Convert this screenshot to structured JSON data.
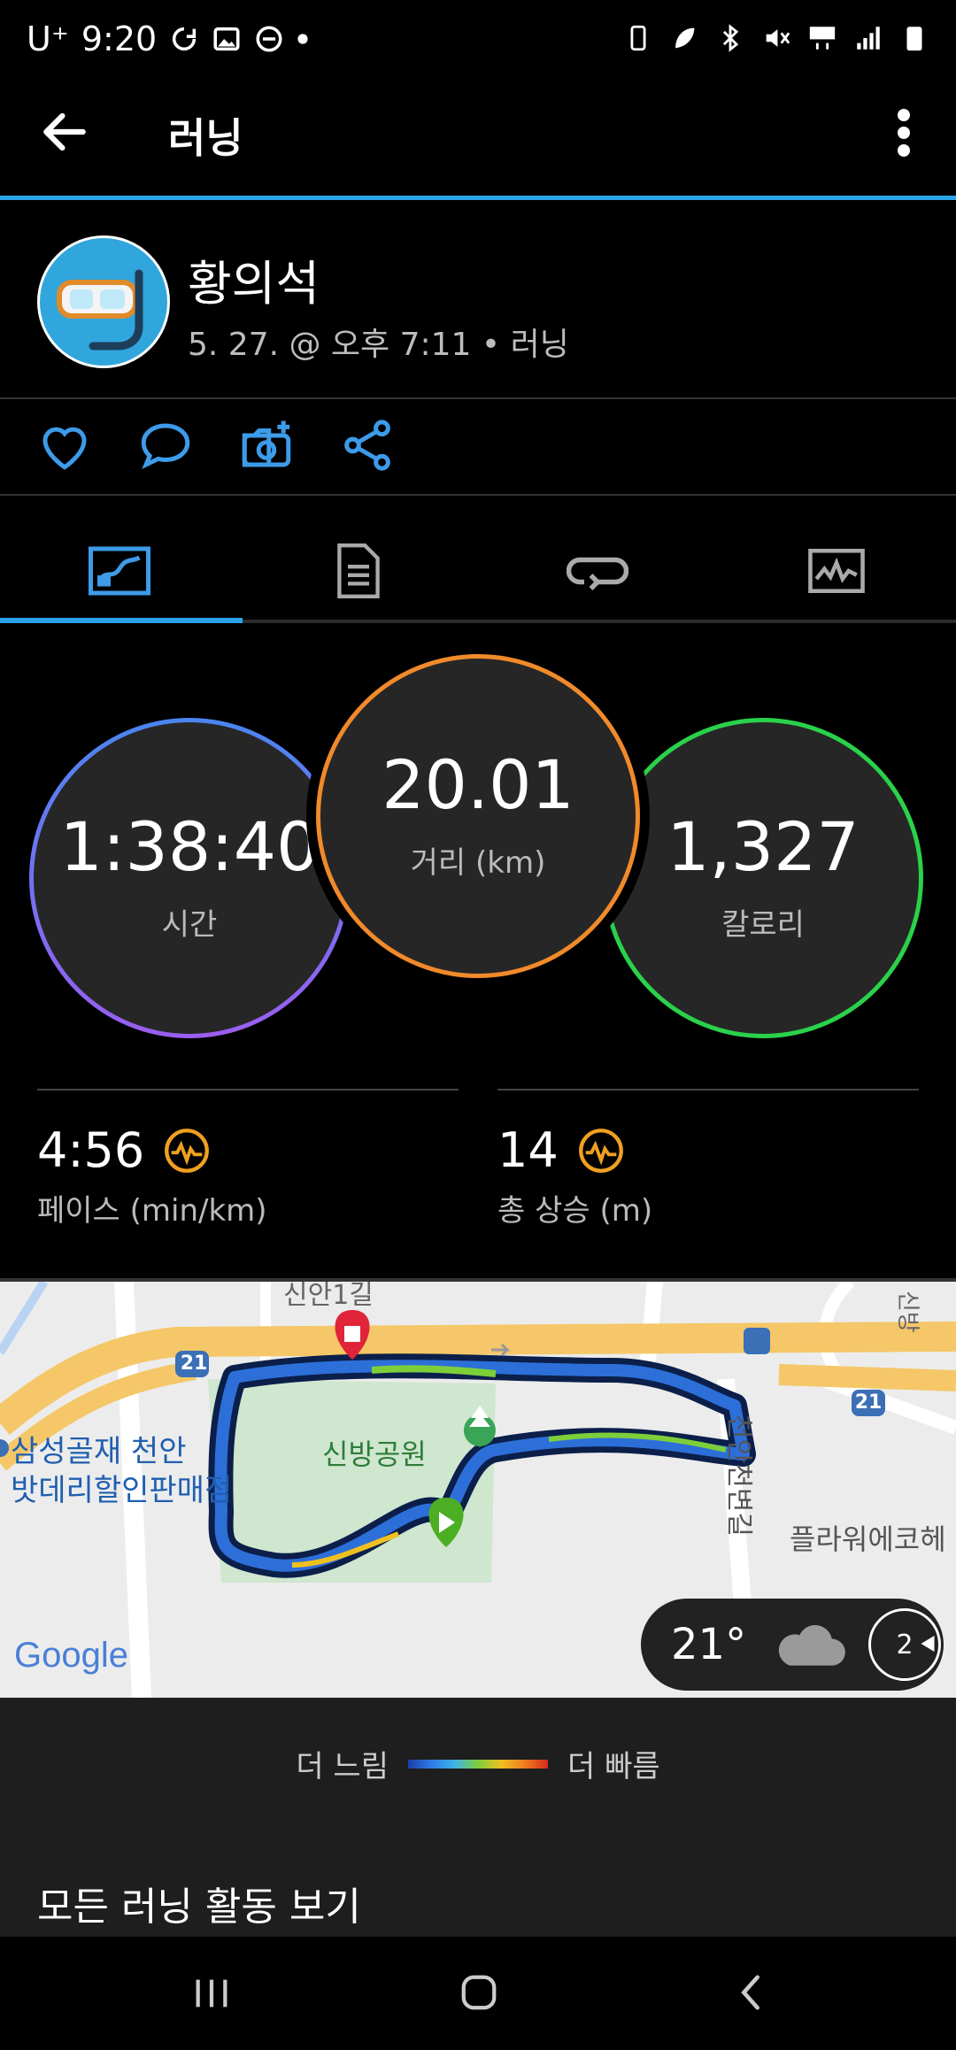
{
  "status_bar": {
    "carrier": "U⁺",
    "time": "9:20"
  },
  "header": {
    "title": "러닝"
  },
  "activity": {
    "user_name": "황의석",
    "meta": "5. 27. @ 오후 7:11 • 러닝"
  },
  "metrics": {
    "time": {
      "value": "1:38:40",
      "label": "시간"
    },
    "distance": {
      "value": "20.01",
      "label": "거리 (km)"
    },
    "calories": {
      "value": "1,327",
      "label": "칼로리"
    }
  },
  "stats": {
    "pace": {
      "value": "4:56",
      "label": "페이스 (min/km)"
    },
    "ascent": {
      "value": "14",
      "label": "총 상승 (m)"
    }
  },
  "map": {
    "labels": {
      "road_top": "21",
      "road_right": "21",
      "park": "신방공원",
      "store_line1": "삼성골재 천안",
      "store_line2": "밧데리할인판매점",
      "street": "천안천변길",
      "flower": "플라워에코헤",
      "top_fragment": "신안1길",
      "right_fragment": "신방",
      "google": "Google"
    },
    "weather": {
      "temp": "21°",
      "wind": "2"
    }
  },
  "legend": {
    "slow": "더 느림",
    "fast": "더 빠름"
  },
  "footer": {
    "all_runs": "모든 러닝 활동 보기"
  },
  "colors": {
    "accent_blue": "#2aa3e8",
    "time_ring": "#8a6cf0",
    "distance_ring": "#f08a2a",
    "calories_ring": "#2ad14a",
    "icon_orange": "#f0a020"
  }
}
